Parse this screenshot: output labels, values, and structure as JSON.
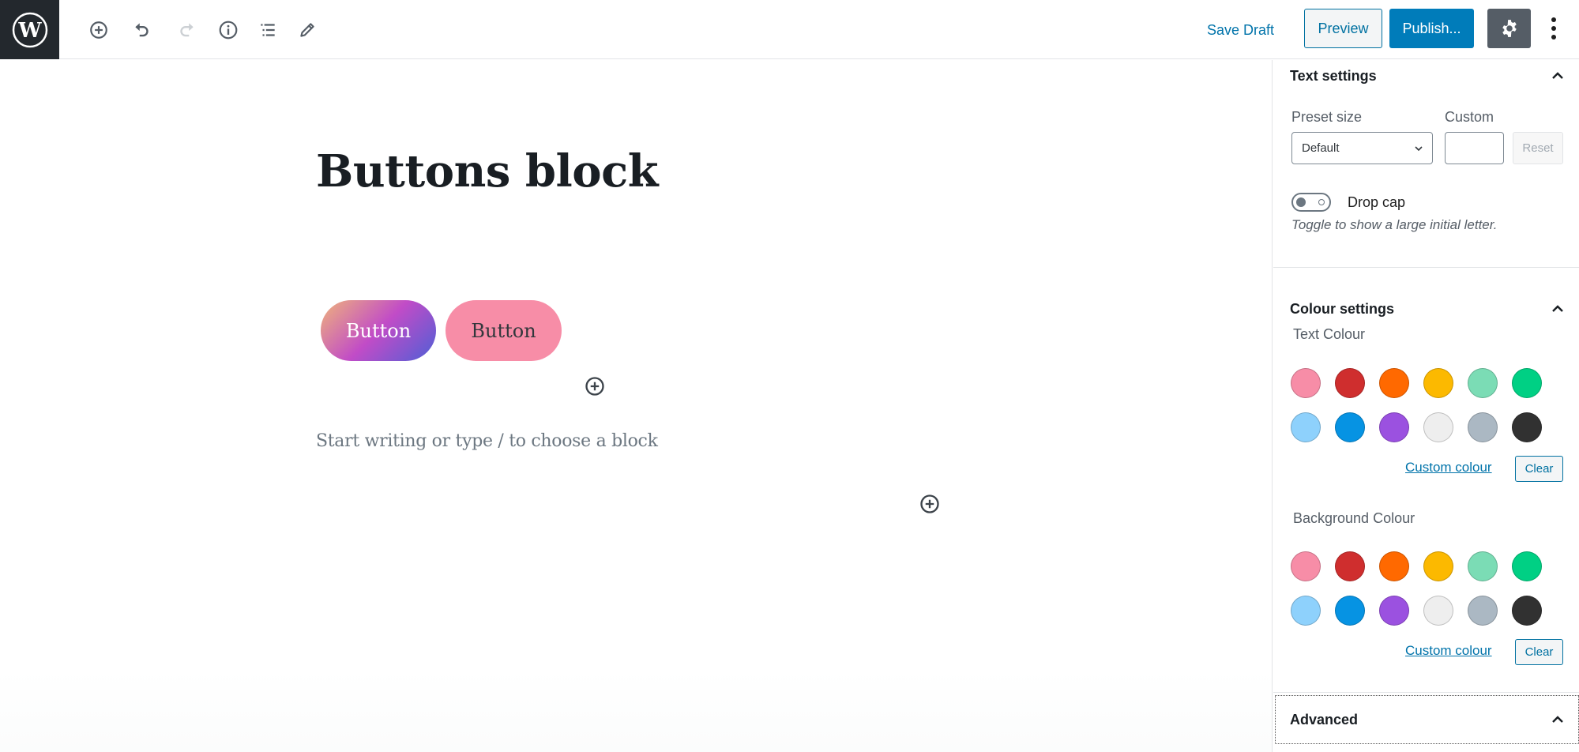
{
  "header": {
    "logo": "wordpress-logo",
    "tools": [
      {
        "name": "add-block",
        "icon": "plus-circle-icon",
        "enabled": true
      },
      {
        "name": "undo",
        "icon": "undo-icon",
        "enabled": true
      },
      {
        "name": "redo",
        "icon": "redo-icon",
        "enabled": false
      },
      {
        "name": "content-structure",
        "icon": "info-icon",
        "enabled": true
      },
      {
        "name": "block-navigation",
        "icon": "list-icon",
        "enabled": true
      },
      {
        "name": "tools",
        "icon": "pencil-icon",
        "enabled": true
      }
    ],
    "save_draft_label": "Save Draft",
    "preview_label": "Preview",
    "publish_label": "Publish...",
    "settings_icon": "gear-icon",
    "more_icon": "more-vertical-icon"
  },
  "editor": {
    "post_title": "Buttons block",
    "buttons": [
      {
        "label": "Button",
        "style": "gradient"
      },
      {
        "label": "Button",
        "style": "pink"
      }
    ],
    "paragraph_placeholder": "Start writing or type / to choose a block"
  },
  "sidebar": {
    "text_settings": {
      "title": "Text settings",
      "preset_size_label": "Preset size",
      "preset_size_value": "Default",
      "custom_label": "Custom",
      "custom_value": "",
      "reset_label": "Reset",
      "drop_cap_label": "Drop cap",
      "drop_cap_enabled": false,
      "drop_cap_help": "Toggle to show a large initial letter."
    },
    "colour_settings": {
      "title": "Colour settings",
      "text_colour_label": "Text Colour",
      "background_colour_label": "Background Colour",
      "palette": [
        "#f78da7",
        "#cf2e2e",
        "#ff6900",
        "#fcb900",
        "#7bdcb5",
        "#00d084",
        "#8ed1fc",
        "#0693e3",
        "#9b51e0",
        "#eeeeee",
        "#abb8c3",
        "#313131"
      ],
      "custom_colour_label": "Custom colour",
      "clear_label": "Clear"
    },
    "advanced": {
      "title": "Advanced"
    }
  },
  "colors": {
    "accent": "#007cba",
    "link": "#0073aa",
    "logo_bg": "#23282d",
    "gear_bg": "#555d66"
  }
}
